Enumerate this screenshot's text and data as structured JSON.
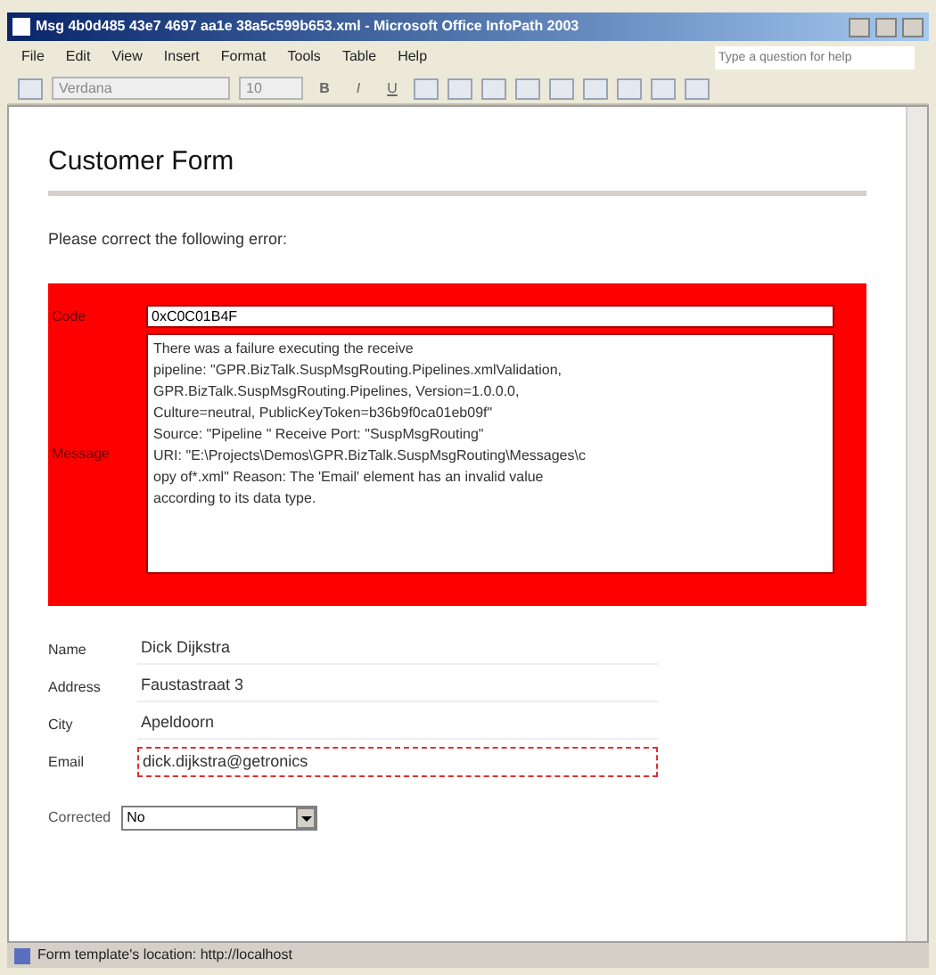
{
  "window": {
    "title": "Msg 4b0d485 43e7 4697 aa1e 38a5c599b653.xml - Microsoft Office InfoPath 2003"
  },
  "menu": [
    {
      "label": "File"
    },
    {
      "label": "Edit"
    },
    {
      "label": "View"
    },
    {
      "label": "Insert"
    },
    {
      "label": "Format"
    },
    {
      "label": "Tools"
    },
    {
      "label": "Table"
    },
    {
      "label": "Help"
    }
  ],
  "help_box": {
    "placeholder": "Type a question for help"
  },
  "toolbar": {
    "font": "Verdana",
    "size": "10",
    "format_buttons": [
      "B",
      "I",
      "U"
    ]
  },
  "form": {
    "title": "Customer Form",
    "intro": "Please correct the following error:",
    "error": {
      "code_label": "Code",
      "code": "0xC0C01B4F",
      "message_label": "Message",
      "message_lines": [
        "There was a failure executing the receive",
        "pipeline: \"GPR.BizTalk.SuspMsgRouting.Pipelines.xmlValidation,",
        "GPR.BizTalk.SuspMsgRouting.Pipelines, Version=1.0.0.0,",
        "Culture=neutral, PublicKeyToken=b36b9f0ca01eb09f\"",
        "Source: \"Pipeline \" Receive Port: \"SuspMsgRouting\"",
        "URI: \"E:\\Projects\\Demos\\GPR.BizTalk.SuspMsgRouting\\Messages\\c",
        "opy of*.xml\" Reason: The 'Email' element has an invalid value",
        "according to its data type."
      ]
    },
    "fields": [
      {
        "label": "Name",
        "value": "Dick Dijkstra",
        "invalid": false
      },
      {
        "label": "Address",
        "value": "Faustastraat 3",
        "invalid": false
      },
      {
        "label": "City",
        "value": "Apeldoorn",
        "invalid": false
      },
      {
        "label": "Email",
        "value": "dick.dijkstra@getronics",
        "invalid": true
      }
    ],
    "corrected": {
      "label": "Corrected",
      "value": "No"
    }
  },
  "status_bar": "Form template's location: http://localhost"
}
